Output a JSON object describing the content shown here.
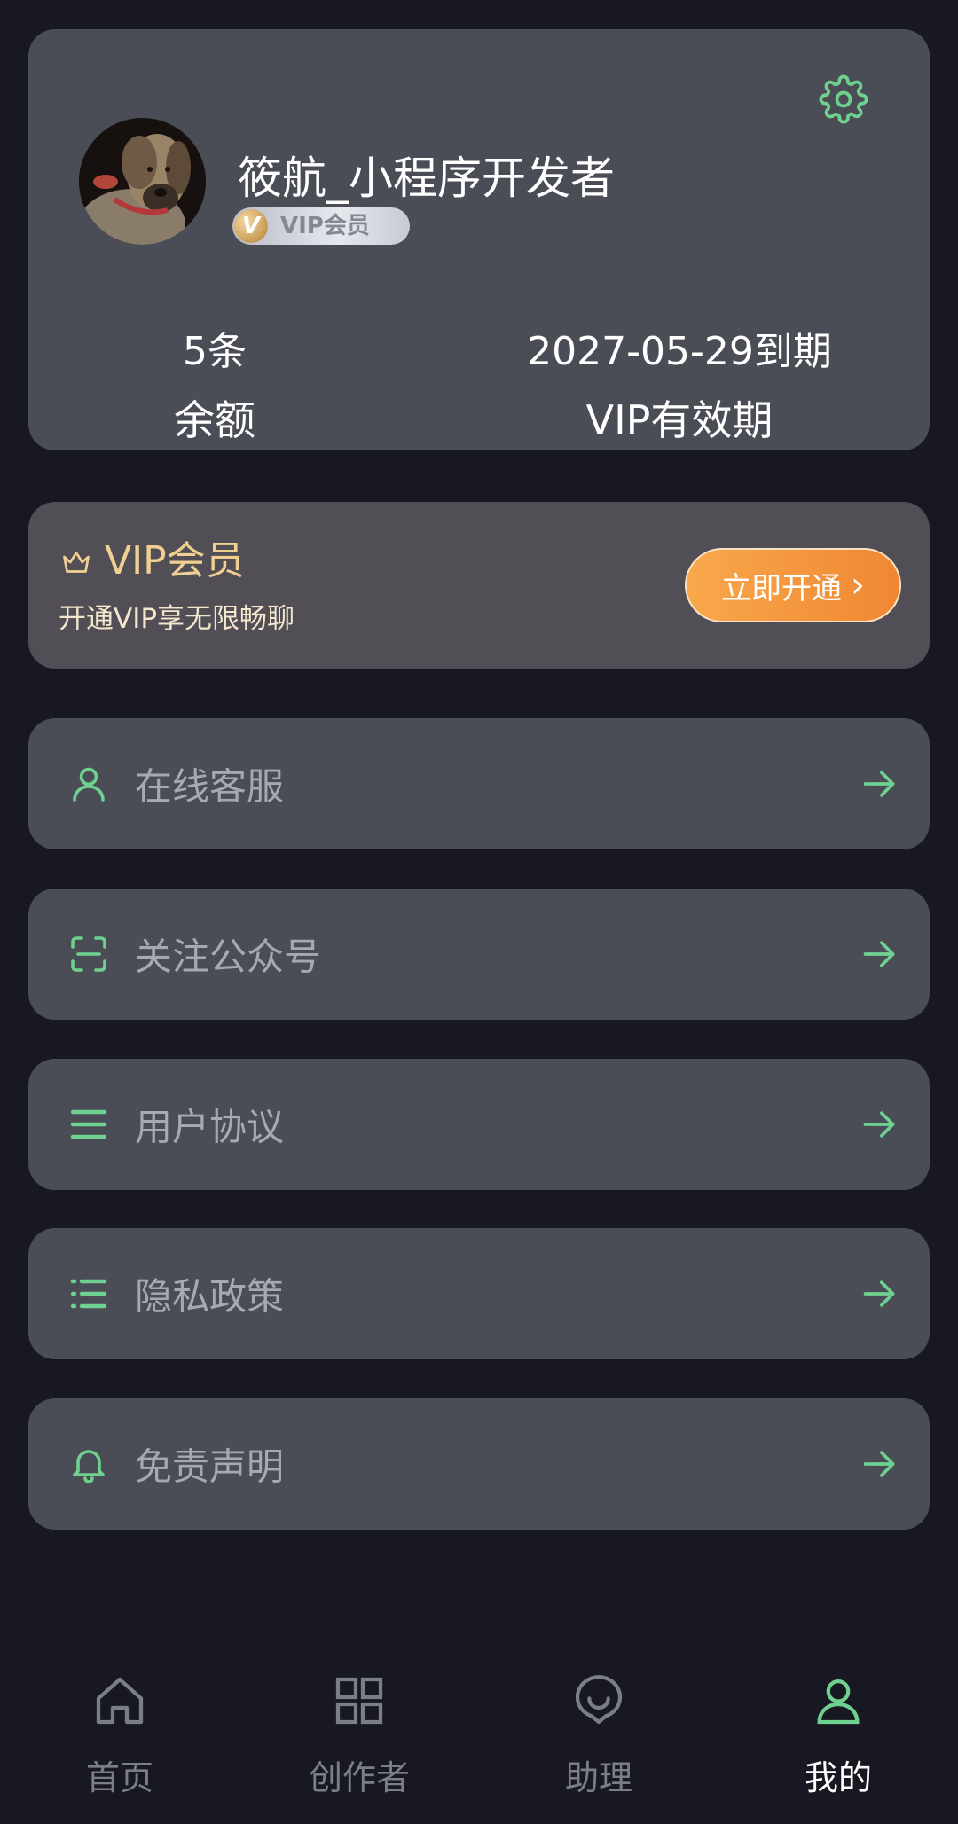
{
  "profile": {
    "username": "筱航_小程序开发者",
    "vip_badge_label": "VIP会员",
    "vip_badge_letter": "V",
    "balance_value": "5条",
    "balance_label": "余额",
    "expiry_value": "2027-05-29到期",
    "expiry_label": "VIP有效期",
    "settings_icon": "gear-icon",
    "avatar_alt": "avatar"
  },
  "vip_promo": {
    "title": "VIP会员",
    "subtitle": "开通VIP享无限畅聊",
    "button_label": "立即开通",
    "button_chevron": "›"
  },
  "menu": [
    {
      "label": "在线客服",
      "icon": "user-icon"
    },
    {
      "label": "关注公众号",
      "icon": "scan-icon"
    },
    {
      "label": "用户协议",
      "icon": "menu-lines-icon"
    },
    {
      "label": "隐私政策",
      "icon": "list-icon"
    },
    {
      "label": "免责声明",
      "icon": "bell-icon"
    }
  ],
  "tabs": [
    {
      "label": "首页",
      "icon": "home-icon",
      "active": false
    },
    {
      "label": "创作者",
      "icon": "grid-icon",
      "active": false
    },
    {
      "label": "助理",
      "icon": "chat-bubble-icon",
      "active": false
    },
    {
      "label": "我的",
      "icon": "profile-icon",
      "active": true
    }
  ],
  "colors": {
    "background": "#171821",
    "card": "#4a4c56",
    "accent_green": "#6fd18f",
    "vip_gold": "#f0cf92",
    "vip_button": "#ef8732"
  }
}
